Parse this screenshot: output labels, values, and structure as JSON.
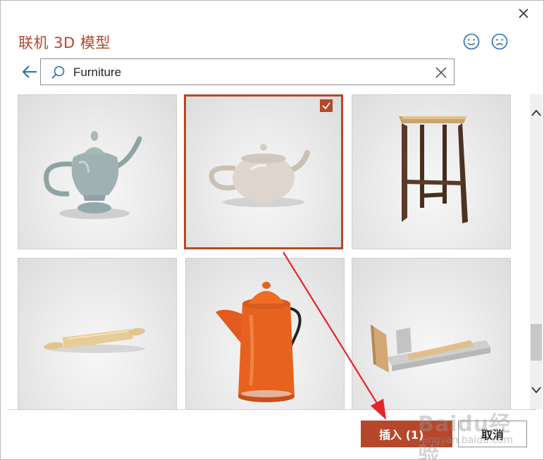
{
  "dialog": {
    "title": "联机 3D 模型"
  },
  "search": {
    "value": "Furniture"
  },
  "models": [
    {
      "name": "teapot-gray",
      "selected": false
    },
    {
      "name": "teapot-white",
      "selected": true
    },
    {
      "name": "bar-stool",
      "selected": false
    },
    {
      "name": "rolling-pin",
      "selected": false
    },
    {
      "name": "coffee-pot-orange",
      "selected": false
    },
    {
      "name": "wooden-ramp",
      "selected": false
    }
  ],
  "footer": {
    "insert_label": "插入 (1)",
    "cancel_label": "取消"
  },
  "watermark": {
    "logo": "Baidu经验",
    "url": "jingyan.baidu.com"
  },
  "colors": {
    "accent": "#b7472a",
    "annotation_arrow": "#e8232a"
  }
}
